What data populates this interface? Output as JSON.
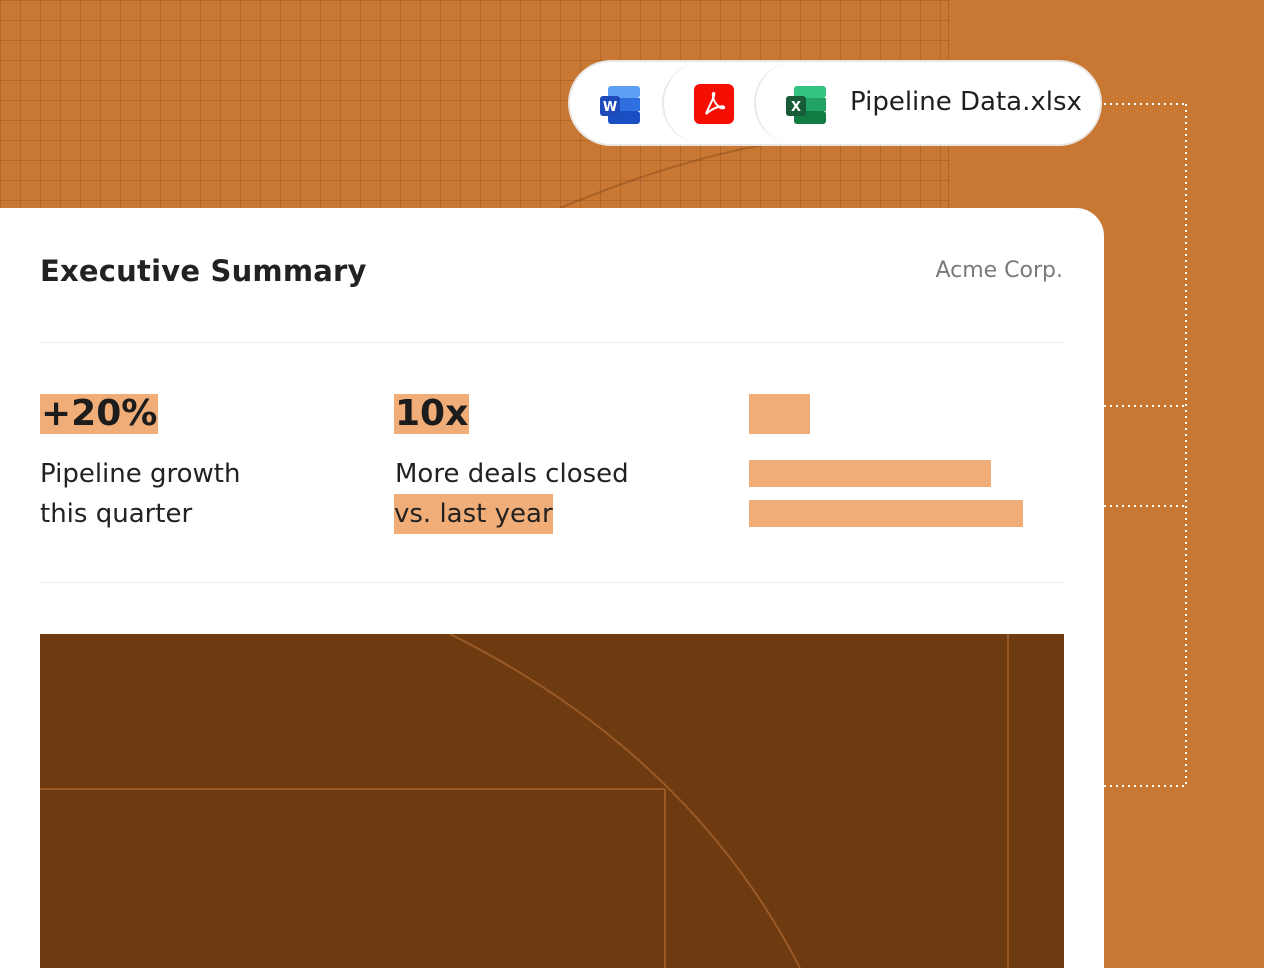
{
  "file_bar": {
    "word_icon": "word-icon",
    "pdf_icon": "pdf-icon",
    "excel_icon": "excel-icon",
    "file_name": "Pipeline Data.xlsx"
  },
  "card": {
    "title": "Executive Summary",
    "company": "Acme Corp."
  },
  "stats": [
    {
      "value": "+20%",
      "line1": "Pipeline growth",
      "line2": "this quarter"
    },
    {
      "value": "10x",
      "line1": "More deals closed",
      "line2": "vs. last year"
    }
  ],
  "colors": {
    "background": "#c97834",
    "highlight": "#f1ad77",
    "panel": "#6e3a0f"
  }
}
